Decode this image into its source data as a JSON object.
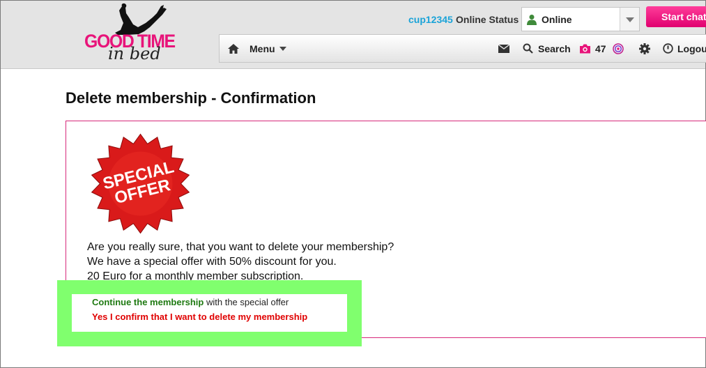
{
  "header": {
    "logo": {
      "line1": "GOOD TIME",
      "line2": "in bed"
    },
    "status": {
      "username": "cup12345",
      "label": "Online Status",
      "selected": "Online"
    },
    "start_chat_label": "Start chat"
  },
  "nav": {
    "menu_label": "Menu",
    "search_label": "Search",
    "photo_count": "47",
    "logout_label": "Logout"
  },
  "main": {
    "title": "Delete membership - Confirmation",
    "badge": {
      "line1": "SPECIAL",
      "line2": "OFFER"
    },
    "messages": [
      "Are you really sure, that you want to delete your membership?",
      "We have a special offer with 50% discount for you.",
      "20 Euro for a monthly member subscription."
    ],
    "continue_link": "Continue the membership",
    "continue_suffix": " with the special offer",
    "confirm_delete_link": "Yes I confirm that I want to delete my membership"
  },
  "colors": {
    "brand_pink": "#e8147a",
    "username_blue": "#1aa3d8",
    "continue_green": "#1f7a12",
    "delete_red": "#e00000",
    "highlight_green": "#80ff6e",
    "panel_border": "#d6287a"
  },
  "icons": [
    "person-icon",
    "home-icon",
    "chevron-down-icon",
    "mail-icon",
    "search-icon",
    "camera-icon",
    "target-icon",
    "gear-icon",
    "power-icon"
  ]
}
